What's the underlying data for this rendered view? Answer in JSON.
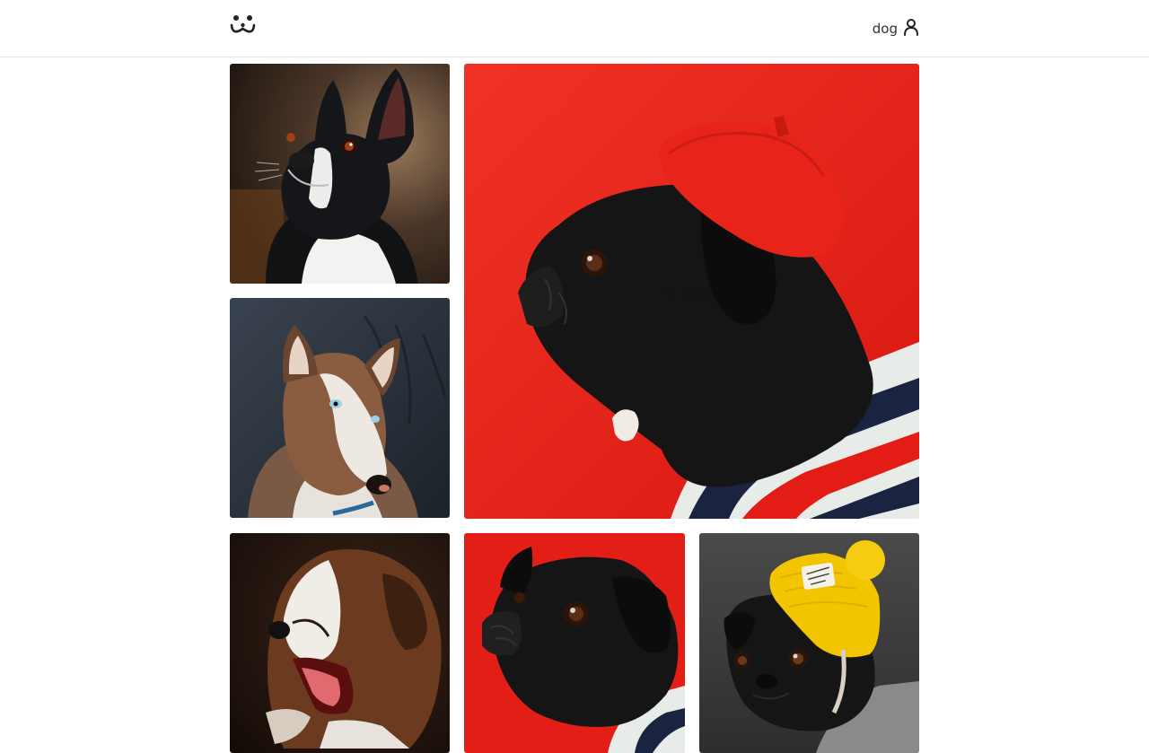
{
  "header": {
    "logo_icon": "smile-logo-icon",
    "username": "dog",
    "user_icon": "user-icon"
  },
  "photos": [
    {
      "subject": "boston-terrier",
      "bg": "#3d2e22"
    },
    {
      "subject": "pug-red-beret",
      "bg": "#e6231c",
      "views": "11584"
    },
    {
      "subject": "husky",
      "bg": "#2c3540"
    },
    {
      "subject": "yawning-puppy",
      "bg": "#2a1a12"
    },
    {
      "subject": "pug-red-background",
      "bg": "#e21e17"
    },
    {
      "subject": "pug-yellow-beanie",
      "bg": "#3b3b3b"
    }
  ],
  "colors": {
    "border": "#e6e6e6",
    "beret": "#e8231a",
    "beanie": "#f2c500",
    "text": "#333333"
  }
}
